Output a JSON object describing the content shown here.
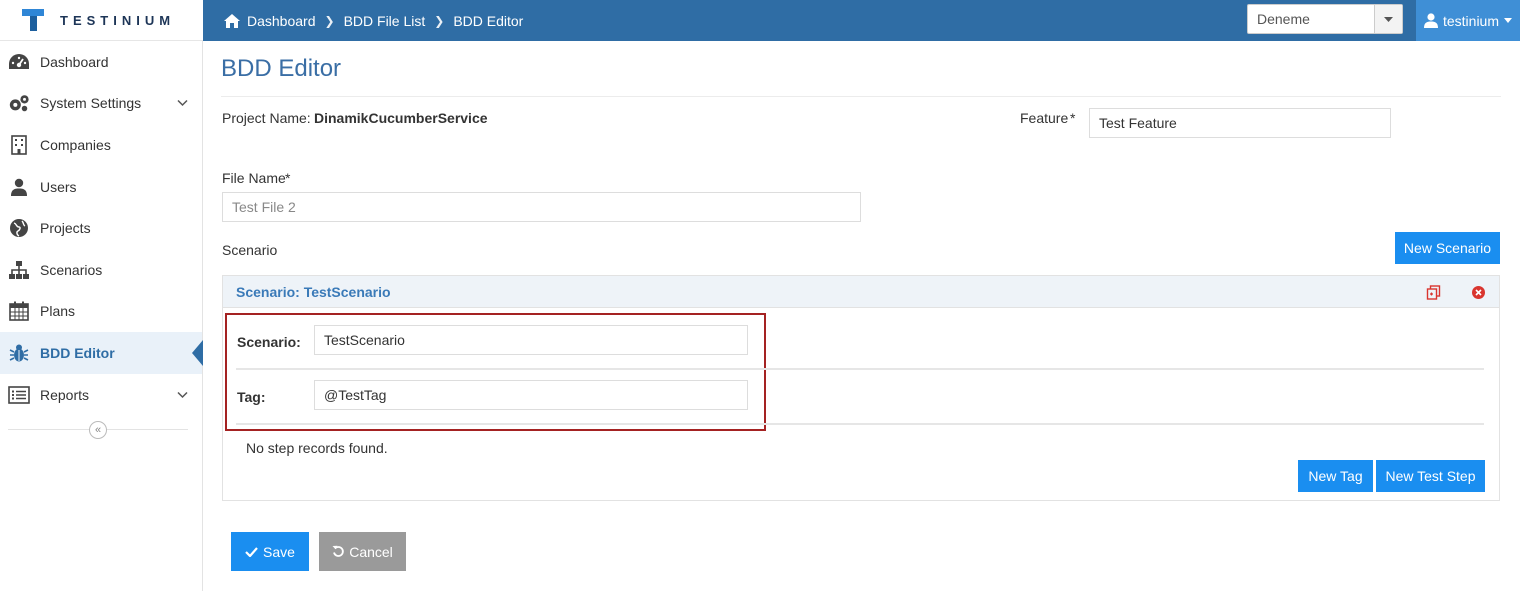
{
  "brand": {
    "name": "TESTINIUM"
  },
  "breadcrumb": [
    {
      "label": "Dashboard"
    },
    {
      "label": "BDD File List"
    },
    {
      "label": "BDD Editor"
    }
  ],
  "project_select": {
    "value": "Deneme"
  },
  "user": {
    "name": "testinium"
  },
  "sidebar": {
    "items": [
      {
        "label": "Dashboard",
        "icon": "dashboard-icon"
      },
      {
        "label": "System Settings",
        "icon": "gears-icon",
        "expandable": true
      },
      {
        "label": "Companies",
        "icon": "building-icon"
      },
      {
        "label": "Users",
        "icon": "user-icon"
      },
      {
        "label": "Projects",
        "icon": "globe-icon"
      },
      {
        "label": "Scenarios",
        "icon": "sitemap-icon"
      },
      {
        "label": "Plans",
        "icon": "calendar-icon"
      },
      {
        "label": "BDD Editor",
        "icon": "bug-icon",
        "active": true
      },
      {
        "label": "Reports",
        "icon": "list-icon",
        "expandable": true
      }
    ]
  },
  "page": {
    "title": "BDD Editor",
    "project_name_label": "Project Name:",
    "project_name_value": "DinamikCucumberService",
    "feature_label": "Feature",
    "feature_required": "*",
    "feature_value": "Test Feature",
    "file_name_label": "File Name",
    "file_name_required": "*",
    "file_name_value": "Test File 2",
    "scenario_section_label": "Scenario",
    "new_scenario_button": "New Scenario"
  },
  "scenario_panel": {
    "header": "Scenario: TestScenario",
    "scenario_label": "Scenario:",
    "scenario_value": "TestScenario",
    "tag_label": "Tag:",
    "tag_value": "@TestTag",
    "empty_steps": "No step records found.",
    "new_tag_button": "New Tag",
    "new_test_step_button": "New Test Step"
  },
  "actions": {
    "save": "Save",
    "cancel": "Cancel"
  },
  "colors": {
    "navbar": "#2f6da5",
    "user_box": "#3f8fd6",
    "primary_button": "#1a8ef0",
    "cancel_button": "#9a9a9a",
    "highlight_border": "#a42222",
    "title": "#3a6ea5"
  }
}
